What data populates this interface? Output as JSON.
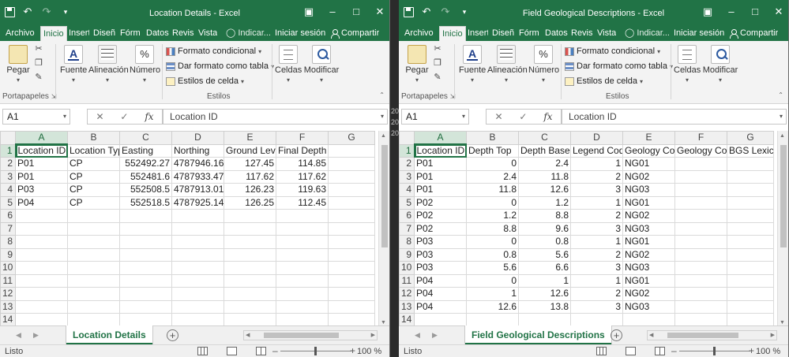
{
  "windows": [
    {
      "id": "left",
      "title": "Location Details - Excel",
      "tabs": [
        "Archivo",
        "Inicio",
        "Insert",
        "Diseñ",
        "Fórm",
        "Datos",
        "Revisi",
        "Vista"
      ],
      "tell_me": "Indicar...",
      "sign_in": "Iniciar sesión",
      "share": "Compartir",
      "ribbon": {
        "paste": "Pegar",
        "font": "Fuente",
        "alignment": "Alineación",
        "number": "Número",
        "conditional_format": "Formato condicional",
        "format_as_table": "Dar formato como tabla",
        "cell_styles": "Estilos de celda",
        "cells": "Celdas",
        "editing": "Modificar",
        "group_clipboard": "Portapapeles",
        "group_styles": "Estilos"
      },
      "name_box": "A1",
      "formula": "Location ID",
      "columns": [
        "A",
        "B",
        "C",
        "D",
        "E",
        "F",
        "G"
      ],
      "rows": [
        [
          "Location ID",
          "Location Typ",
          "Easting",
          "Northing",
          "Ground Leve",
          "Final Depth",
          ""
        ],
        [
          "P01",
          "CP",
          "552492.27",
          "4787946.16",
          "127.45",
          "114.85",
          ""
        ],
        [
          "P01",
          "CP",
          "552481.6",
          "4787933.47",
          "117.62",
          "117.62",
          ""
        ],
        [
          "P03",
          "CP",
          "552508.5",
          "4787913.01",
          "126.23",
          "119.63",
          ""
        ],
        [
          "P04",
          "CP",
          "552518.5",
          "4787925.14",
          "126.25",
          "112.45",
          ""
        ],
        [
          "",
          "",
          "",
          "",
          "",
          "",
          ""
        ],
        [
          "",
          "",
          "",
          "",
          "",
          "",
          ""
        ],
        [
          "",
          "",
          "",
          "",
          "",
          "",
          ""
        ],
        [
          "",
          "",
          "",
          "",
          "",
          "",
          ""
        ],
        [
          "",
          "",
          "",
          "",
          "",
          "",
          ""
        ],
        [
          "",
          "",
          "",
          "",
          "",
          "",
          ""
        ],
        [
          "",
          "",
          "",
          "",
          "",
          "",
          ""
        ],
        [
          "",
          "",
          "",
          "",
          "",
          "",
          ""
        ],
        [
          "",
          "",
          "",
          "",
          "",
          "",
          ""
        ]
      ],
      "row_numbers": [
        "1",
        "2",
        "3",
        "4",
        "5",
        "6",
        "7",
        "8",
        "9",
        "10",
        "11",
        "12",
        "13",
        "14"
      ],
      "sheet_tab": "Location Details",
      "status": "Listo",
      "zoom": "100 %"
    },
    {
      "id": "right",
      "title": "Field Geological Descriptions - Excel",
      "tabs": [
        "Archivo",
        "Inicio",
        "Insert",
        "Diseñ",
        "Fórm",
        "Datos",
        "Revisi",
        "Vista"
      ],
      "tell_me": "Indicar...",
      "sign_in": "Iniciar sesión",
      "share": "Compartir",
      "ribbon": {
        "paste": "Pegar",
        "font": "Fuente",
        "alignment": "Alineación",
        "number": "Número",
        "conditional_format": "Formato condicional",
        "format_as_table": "Dar formato como tabla",
        "cell_styles": "Estilos de celda",
        "cells": "Celdas",
        "editing": "Modificar",
        "group_clipboard": "Portapapeles",
        "group_styles": "Estilos"
      },
      "name_box": "A1",
      "formula": "Location ID",
      "columns": [
        "A",
        "B",
        "C",
        "D",
        "E",
        "F",
        "G"
      ],
      "rows": [
        [
          "Location ID",
          "Depth Top",
          "Depth Base",
          "Legend Code",
          "Geology Cod",
          "Geology Cod",
          "BGS Lexicor"
        ],
        [
          "P01",
          "0",
          "2.4",
          "1",
          "NG01",
          "",
          ""
        ],
        [
          "P01",
          "2.4",
          "11.8",
          "2",
          "NG02",
          "",
          ""
        ],
        [
          "P01",
          "11.8",
          "12.6",
          "3",
          "NG03",
          "",
          ""
        ],
        [
          "P02",
          "0",
          "1.2",
          "1",
          "NG01",
          "",
          ""
        ],
        [
          "P02",
          "1.2",
          "8.8",
          "2",
          "NG02",
          "",
          ""
        ],
        [
          "P02",
          "8.8",
          "9.6",
          "3",
          "NG03",
          "",
          ""
        ],
        [
          "P03",
          "0",
          "0.8",
          "1",
          "NG01",
          "",
          ""
        ],
        [
          "P03",
          "0.8",
          "5.6",
          "2",
          "NG02",
          "",
          ""
        ],
        [
          "P03",
          "5.6",
          "6.6",
          "3",
          "NG03",
          "",
          ""
        ],
        [
          "P04",
          "0",
          "1",
          "1",
          "NG01",
          "",
          ""
        ],
        [
          "P04",
          "1",
          "12.6",
          "2",
          "NG02",
          "",
          ""
        ],
        [
          "P04",
          "12.6",
          "13.8",
          "3",
          "NG03",
          "",
          ""
        ],
        [
          "",
          "",
          "",
          "",
          "",
          "",
          ""
        ]
      ],
      "row_numbers": [
        "1",
        "2",
        "3",
        "4",
        "5",
        "6",
        "7",
        "8",
        "9",
        "10",
        "11",
        "12",
        "13",
        "14"
      ],
      "sheet_tab": "Field Geological Descriptions",
      "status": "Listo",
      "zoom": "100 %"
    }
  ],
  "gap_marks": [
    "20",
    "20",
    "20"
  ],
  "colors": {
    "excel_green": "#217346",
    "ribbon_bg": "#f3f3f3",
    "selection": "#d3e5d9"
  }
}
